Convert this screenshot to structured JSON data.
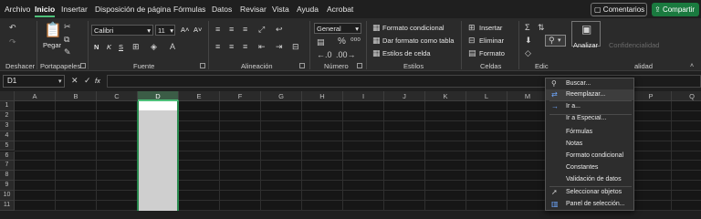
{
  "menu_tabs": {
    "archivo": "Archivo",
    "inicio": "Inicio",
    "insertar": "Insertar",
    "disposicion": "Disposición de página",
    "formulas": "Fórmulas",
    "datos": "Datos",
    "revisar": "Revisar",
    "vista": "Vista",
    "ayuda": "Ayuda",
    "acrobat": "Acrobat"
  },
  "header_buttons": {
    "comentarios": "Comentarios",
    "compartir": "Compartir"
  },
  "ribbon": {
    "groups": {
      "deshacer": "Deshacer",
      "portapapeles": "Portapapeles",
      "fuente": "Fuente",
      "alineacion": "Alineación",
      "numero": "Número",
      "estilos": "Estilos",
      "celdas": "Celdas",
      "edicion": "Edic",
      "analisis": "alidad"
    },
    "pegar": "Pegar",
    "font_name": "Calibri",
    "font_size": "11",
    "bold": "N",
    "italic": "K",
    "underline": "S",
    "number_format": "General",
    "formato_condicional": "Formato condicional",
    "dar_formato_tabla": "Dar formato como tabla",
    "estilos_celda": "Estilos de celda",
    "insertar": "Insertar",
    "eliminar": "Eliminar",
    "formato": "Formato",
    "analizar": "Analizar",
    "confidencialidad": "Confidencialidad"
  },
  "formula_bar": {
    "name_box": "D1",
    "fx": "fx"
  },
  "grid": {
    "columns": [
      "A",
      "B",
      "C",
      "D",
      "E",
      "F",
      "G",
      "H",
      "I",
      "J",
      "K",
      "L",
      "M",
      "N",
      "O",
      "P",
      "Q"
    ],
    "rows": [
      "1",
      "2",
      "3",
      "4",
      "5",
      "6",
      "7",
      "8",
      "9",
      "10",
      "11"
    ],
    "selected_column": "D"
  },
  "dropdown": {
    "items": [
      {
        "label": "Buscar...",
        "icon": "search-icon"
      },
      {
        "label": "Reemplazar...",
        "icon": "replace-icon"
      },
      {
        "label": "Ir a...",
        "icon": "arrow-right-icon"
      },
      {
        "label": "Ir a Especial...",
        "icon": ""
      },
      {
        "label": "Fórmulas",
        "icon": ""
      },
      {
        "label": "Notas",
        "icon": ""
      },
      {
        "label": "Formato condicional",
        "icon": ""
      },
      {
        "label": "Constantes",
        "icon": ""
      },
      {
        "label": "Validación de datos",
        "icon": ""
      },
      {
        "label": "Seleccionar objetos",
        "icon": "cursor-icon"
      },
      {
        "label": "Panel de selección...",
        "icon": "selection-pane-icon"
      }
    ]
  },
  "colors": {
    "accent_green": "#4ec07a",
    "share_green": "#1a7a3f"
  }
}
